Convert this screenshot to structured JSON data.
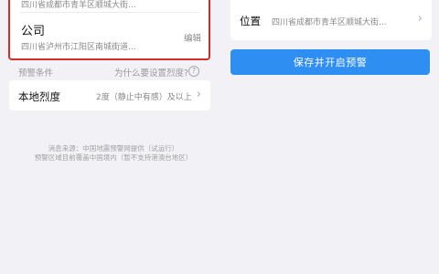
{
  "left": {
    "home_address_partial": "四川省成都市青羊区顺城大街...",
    "company": {
      "name": "公司",
      "address": "四川省泸州市江阳区南城街道...",
      "edit_label": "编辑"
    },
    "alert_condition_label": "预警条件",
    "why_set_intensity": "为什么要设置烈度?",
    "help_icon_glyph": "?",
    "local_intensity": {
      "label": "本地烈度",
      "value": "2度（静止中有感）及以上"
    },
    "footnote_line1": "消息来源：中国地震预警网提供（试运行）",
    "footnote_line2": "预警区域目前覆盖中国境内（暂不支持港澳台地区）"
  },
  "right": {
    "location": {
      "label": "位置",
      "value": "四川省成都市青羊区顺城大街..."
    },
    "save_button": "保存并开启预警"
  },
  "icons": {
    "chevron": "chevron-right-icon"
  },
  "colors": {
    "highlight_border": "#d42a2a",
    "primary_button": "#2e8ef2",
    "background": "#f2f2f6"
  }
}
